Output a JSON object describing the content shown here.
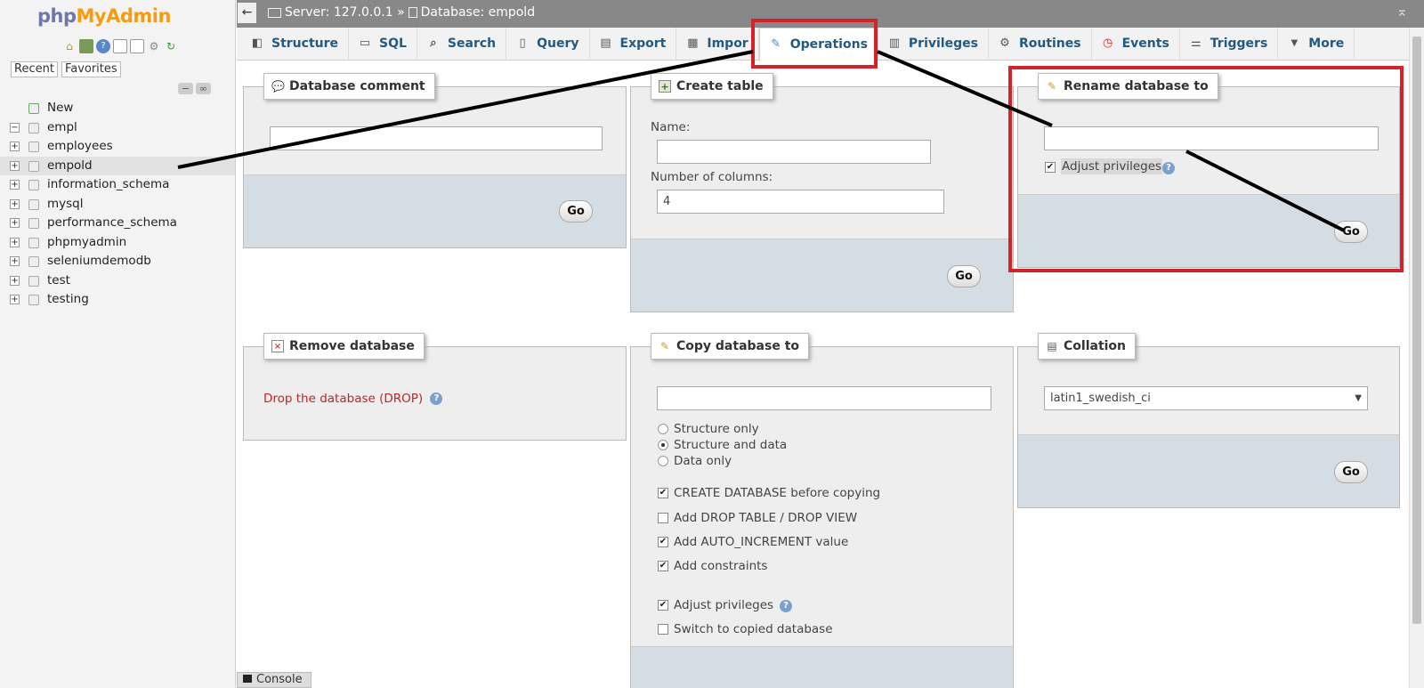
{
  "nav": {
    "logo_part1": "php",
    "logo_part2": "MyAdmin",
    "tab_recent": "Recent",
    "tab_favorites": "Favorites",
    "tree": [
      {
        "label": "New",
        "icon": "new-icon",
        "selected": false,
        "expander": ""
      },
      {
        "label": "empl",
        "icon": "database-icon",
        "selected": false,
        "expander": "−"
      },
      {
        "label": "employees",
        "icon": "database-icon",
        "selected": false,
        "expander": "+"
      },
      {
        "label": "empold",
        "icon": "database-icon",
        "selected": true,
        "expander": "+"
      },
      {
        "label": "information_schema",
        "icon": "database-icon",
        "selected": false,
        "expander": "+"
      },
      {
        "label": "mysql",
        "icon": "database-icon",
        "selected": false,
        "expander": "+"
      },
      {
        "label": "performance_schema",
        "icon": "database-icon",
        "selected": false,
        "expander": "+"
      },
      {
        "label": "phpmyadmin",
        "icon": "database-icon",
        "selected": false,
        "expander": "+"
      },
      {
        "label": "seleniumdemodb",
        "icon": "database-icon",
        "selected": false,
        "expander": "+"
      },
      {
        "label": "test",
        "icon": "database-icon",
        "selected": false,
        "expander": "+"
      },
      {
        "label": "testing",
        "icon": "database-icon",
        "selected": false,
        "expander": "+"
      }
    ]
  },
  "topbar": {
    "server": "Server: 127.0.0.1 »",
    "database": "Database: empold"
  },
  "tabs": [
    {
      "label": "Structure",
      "icon": "structure-icon",
      "active": false
    },
    {
      "label": "SQL",
      "icon": "sql-icon",
      "active": false
    },
    {
      "label": "Search",
      "icon": "search-icon",
      "active": false
    },
    {
      "label": "Query",
      "icon": "query-icon",
      "active": false
    },
    {
      "label": "Export",
      "icon": "export-icon",
      "active": false
    },
    {
      "label": "Impor",
      "icon": "import-icon",
      "active": false
    },
    {
      "label": "Operations",
      "icon": "wrench-icon",
      "active": true
    },
    {
      "label": "Privileges",
      "icon": "privileges-icon",
      "active": false
    },
    {
      "label": "Routines",
      "icon": "routines-icon",
      "active": false
    },
    {
      "label": "Events",
      "icon": "clock-icon",
      "active": false
    },
    {
      "label": "Triggers",
      "icon": "triggers-icon",
      "active": false
    },
    {
      "label": "More",
      "icon": "caret-down-icon",
      "active": false
    }
  ],
  "db_comment": {
    "title": "Database comment",
    "value": "",
    "go": "Go"
  },
  "create_table": {
    "title": "Create table",
    "name_label": "Name:",
    "name_value": "",
    "columns_label": "Number of columns:",
    "columns_value": "4",
    "go": "Go"
  },
  "rename_db": {
    "title": "Rename database to",
    "value": "",
    "adjust_privileges": "Adjust privileges",
    "adjust_checked": true,
    "go": "Go"
  },
  "remove_db": {
    "title": "Remove database",
    "drop_link": "Drop the database (DROP)"
  },
  "copy_db": {
    "title": "Copy database to",
    "value": "",
    "radio_options": [
      "Structure only",
      "Structure and data",
      "Data only"
    ],
    "radio_selected": "Structure and data",
    "checkboxes": [
      {
        "label": "CREATE DATABASE before copying",
        "checked": true
      },
      {
        "label": "Add DROP TABLE / DROP VIEW",
        "checked": false
      },
      {
        "label": "Add AUTO_INCREMENT value",
        "checked": true
      },
      {
        "label": "Add constraints",
        "checked": true
      },
      {
        "label": "Adjust privileges",
        "checked": true
      },
      {
        "label": "Switch to copied database",
        "checked": false
      }
    ]
  },
  "collation": {
    "title": "Collation",
    "selected": "latin1_swedish_ci",
    "go": "Go"
  },
  "console": {
    "label": "Console"
  },
  "colors": {
    "annotation_red": "#d42328",
    "link_blue": "#235a81",
    "drop_red": "#c02525"
  }
}
